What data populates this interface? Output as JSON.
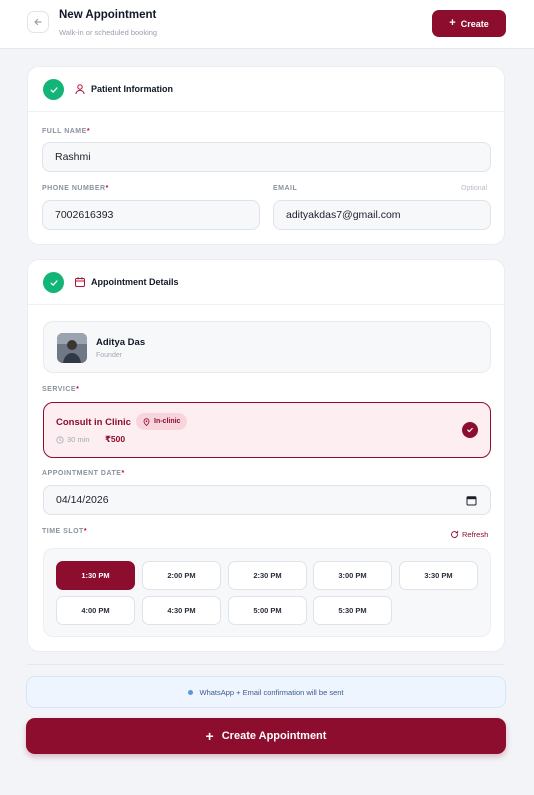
{
  "header": {
    "title": "New Appointment",
    "subtitle": "Walk-in or scheduled booking",
    "create_label": "Create"
  },
  "patient": {
    "section_title": "Patient Information",
    "full_name_label": "FULL NAME",
    "full_name_value": "Rashmi",
    "phone_label": "PHONE NUMBER",
    "phone_value": "7002616393",
    "email_label": "EMAIL",
    "email_optional": "Optional",
    "email_value": "adityakdas7@gmail.com",
    "required_mark": "*"
  },
  "appointment": {
    "section_title": "Appointment Details",
    "doctor_name": "Aditya Das",
    "doctor_role": "Founder",
    "service_label": "SERVICE",
    "service_name": "Consult in Clinic",
    "service_badge": "In-clinic",
    "service_duration": "30 min",
    "service_price": "₹500",
    "date_label": "APPOINTMENT DATE",
    "date_value": "04/14/2026",
    "time_slot_label": "TIME SLOT",
    "refresh_label": "Refresh",
    "slots": [
      "1:30 PM",
      "2:00 PM",
      "2:30 PM",
      "3:00 PM",
      "3:30 PM",
      "4:00 PM",
      "4:30 PM",
      "5:00 PM",
      "5:30 PM"
    ],
    "selected_slot": "1:30 PM"
  },
  "footer": {
    "notice": "WhatsApp + Email confirmation will be sent",
    "submit_label": "Create Appointment"
  },
  "colors": {
    "brand": "#8d0d2e",
    "success": "#12b477",
    "notice_bg": "#eef5fe"
  }
}
